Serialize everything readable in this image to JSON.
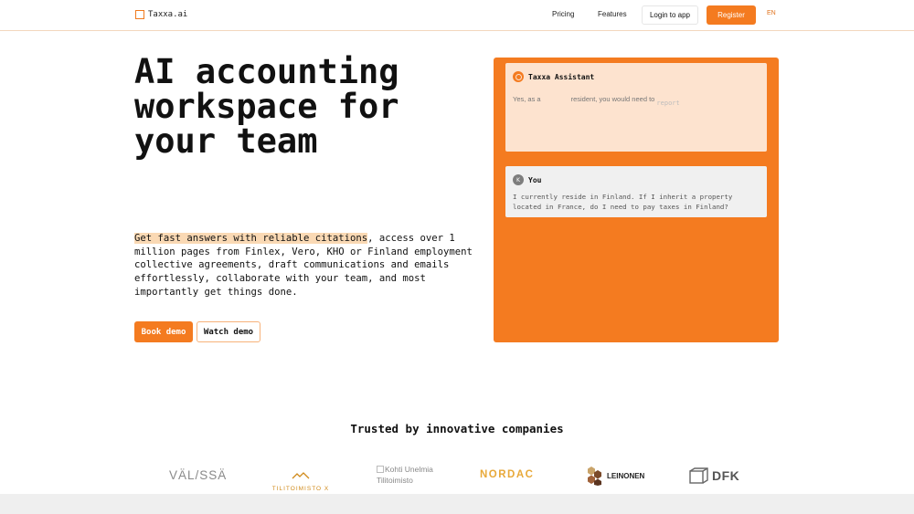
{
  "nav": {
    "brand": "Taxxa.ai",
    "links": [
      "Pricing",
      "Features"
    ],
    "login_label": "Login to app",
    "register_label": "Register",
    "language": "EN"
  },
  "hero": {
    "title": "AI accounting workspace for your team",
    "highlight": "Get fast answers with reliable citations",
    "body": ", access over 1 million pages from Finlex, Vero, KHO or Finland employment collective agreements, draft communications and emails effortlessly, collaborate with your team, and most importantly get things done.",
    "book_demo_label": "Book demo",
    "watch_demo_label": "Watch demo"
  },
  "chat": {
    "assistant_name": "Taxxa Assistant",
    "assistant_message_start": "Yes, as a",
    "assistant_message_mid": "resident, you would need to",
    "assistant_message_fade": "report",
    "user_name": "You",
    "user_avatar": "K",
    "user_message": "I currently reside in Finland. If I inherit a property located in France, do I need to pay taxes in Finland?"
  },
  "trusted": {
    "heading": "Trusted by innovative companies",
    "logos": {
      "valssa": "VÄL/SSÄ",
      "tilitoimisto": "TILITOIMISTO X",
      "kohti_line1": "Kohti Unelmia",
      "kohti_line2": "Tilitoimisto",
      "nordac": "NORDAC",
      "leinonen": "LEINONEN",
      "dfk": "DFK"
    }
  },
  "colors": {
    "accent": "#f47b20",
    "highlight": "#fad9b4",
    "assistant_card": "#fde3cf",
    "user_card": "#f0f0f0"
  }
}
